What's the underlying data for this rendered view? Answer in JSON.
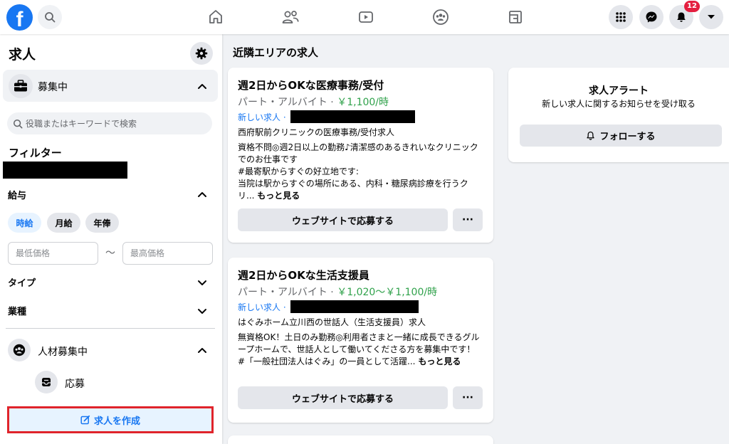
{
  "topbar": {
    "logo": "f",
    "notifications_count": "12",
    "icons": [
      "home-icon",
      "friends-icon",
      "watch-icon",
      "groups-icon",
      "gaming-icon",
      "menu-grid-icon",
      "messenger-icon",
      "bell-icon",
      "account-caret-icon"
    ]
  },
  "sidebar": {
    "title": "求人",
    "hiring_section": "募集中",
    "search_placeholder": "役職またはキーワードで検索",
    "filter_title": "フィルター",
    "salary_label": "給与",
    "salary_options": [
      "時給",
      "月給",
      "年俸"
    ],
    "selected_salary": "時給",
    "min_price_placeholder": "最低価格",
    "max_price_placeholder": "最高価格",
    "range_separator": "〜",
    "type_label": "タイプ",
    "industry_label": "業種",
    "recruiting_label": "人材募集中",
    "applications_label": "応募",
    "create_button": "求人を作成"
  },
  "main": {
    "title": "近隣エリアの求人",
    "jobs": [
      {
        "title": "週2日からOKな医療事務/受付",
        "employment_type": "パート・アルバイト · ",
        "salary": "￥1,100/時",
        "new_label": "新しい求人 ·",
        "company": "西府駅前クリニックの医療事務/受付求人",
        "description": "資格不問◎週2日以上の勤務♪清潔感のあるきれいなクリニックでのお仕事です\n#最寄駅からすぐの好立地です:\n当院は駅からすぐの場所にある、内科・糖尿病診療を行うクリ... ",
        "more": "もっと見る",
        "apply": "ウェブサイトで応募する",
        "more_options": "···"
      },
      {
        "title": "週2日からOKな生活支援員",
        "employment_type": "パート・アルバイト · ",
        "salary": "￥1,020〜￥1,100/時",
        "new_label": "新しい求人 ·",
        "company": "はぐみホーム立川西の世話人（生活支援員）求人",
        "description": "無資格OK！土日のみ勤務◎利用者さまと一緒に成長できるグループホームで、世話人として働いてくださる方を募集中です！\n#「一般社団法人はぐみ」の一員として活躍... ",
        "more": "もっと見る",
        "apply": "ウェブサイトで応募する",
        "more_options": "···"
      }
    ]
  },
  "alert": {
    "title": "求人アラート",
    "subtitle": "新しい求人に関するお知らせを受け取る",
    "follow": "フォローする"
  },
  "colors": {
    "brand": "#1877f2",
    "salary_green": "#31a24c",
    "highlight_red": "#e0242b",
    "badge_red": "#e41e3f"
  }
}
